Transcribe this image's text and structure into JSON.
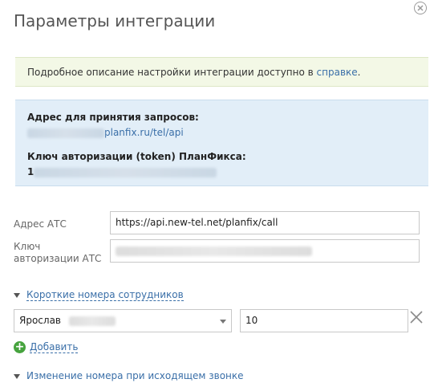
{
  "dialog": {
    "title": "Параметры интеграции"
  },
  "help": {
    "text": "Подробное описание настройки интеграции доступно в ",
    "link": "справке",
    "suffix": "."
  },
  "info": {
    "address_label": "Адрес для принятия запросов:",
    "address_value": "planfix.ru/tel/api",
    "token_label": "Ключ авторизации (token) ПланФикса:",
    "token_prefix": "1"
  },
  "form": {
    "ats_address_label": "Адрес АТС",
    "ats_address_value": "https://api.new-tel.net/planfix/call",
    "ats_key_label_line1": "Ключ",
    "ats_key_label_line2": "авторизации АТС"
  },
  "short_numbers": {
    "toggle_label": "Короткие номера сотрудников",
    "employee_name": "Ярослав",
    "number": "10",
    "add_label": "Добавить"
  },
  "outgoing": {
    "toggle_label": "Изменение номера при исходящем звонке"
  }
}
